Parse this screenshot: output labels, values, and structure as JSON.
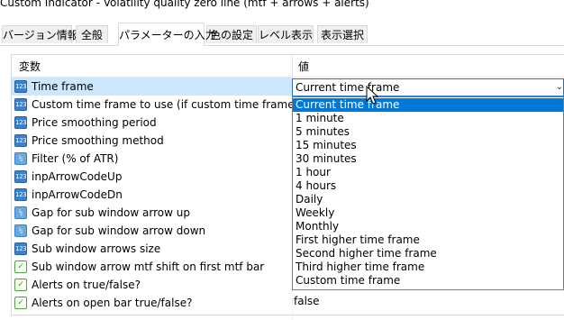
{
  "window": {
    "title": "Custom Indicator - Volatility quality zero line (mtf + arrows + alerts)"
  },
  "tabs": [
    {
      "label": "バージョン情報"
    },
    {
      "label": "全般"
    },
    {
      "label": "パラメーターの入力"
    },
    {
      "label": "色の設定"
    },
    {
      "label": "レベル表示"
    },
    {
      "label": "表示選択"
    }
  ],
  "table": {
    "col_variable": "変数",
    "col_value": "値",
    "rows": [
      {
        "label": "Time frame",
        "icon": "int-icon"
      },
      {
        "label": "Custom time frame to use (if custom time frame used)",
        "icon": "int-icon"
      },
      {
        "label": "Price smoothing period",
        "icon": "int-icon"
      },
      {
        "label": "Price smoothing method",
        "icon": "int-icon"
      },
      {
        "label": "Filter (% of ATR)",
        "icon": "double-icon"
      },
      {
        "label": "inpArrowCodeUp",
        "icon": "int-icon"
      },
      {
        "label": "inpArrowCodeDn",
        "icon": "int-icon"
      },
      {
        "label": "Gap for sub window arrow up",
        "icon": "double-icon"
      },
      {
        "label": "Gap for sub window arrow down",
        "icon": "double-icon"
      },
      {
        "label": "Sub window arrows size",
        "icon": "int-icon"
      },
      {
        "label": "Sub window arrow mtf shift on first mtf bar",
        "icon": "bool-icon"
      },
      {
        "label": "Alerts on true/false?",
        "icon": "bool-icon"
      },
      {
        "label": "Alerts on open bar true/false?",
        "icon": "bool-icon"
      }
    ],
    "icon_text": {
      "int": "123",
      "double": "½",
      "bool": "✓"
    }
  },
  "combo": {
    "value": "Current time frame",
    "options": [
      "Current time frame",
      "1 minute",
      "5 minutes",
      "15 minutes",
      "30 minutes",
      "1 hour",
      "4 hours",
      "Daily",
      "Weekly",
      "Monthly",
      "First higher time frame",
      "Second higher time frame",
      "Third higher time frame",
      "Custom time frame"
    ]
  },
  "last_row_value": "false",
  "colors": {
    "highlight": "#0078d7",
    "selected_row": "#cce8ff",
    "border_focus": "#2b73c8"
  }
}
